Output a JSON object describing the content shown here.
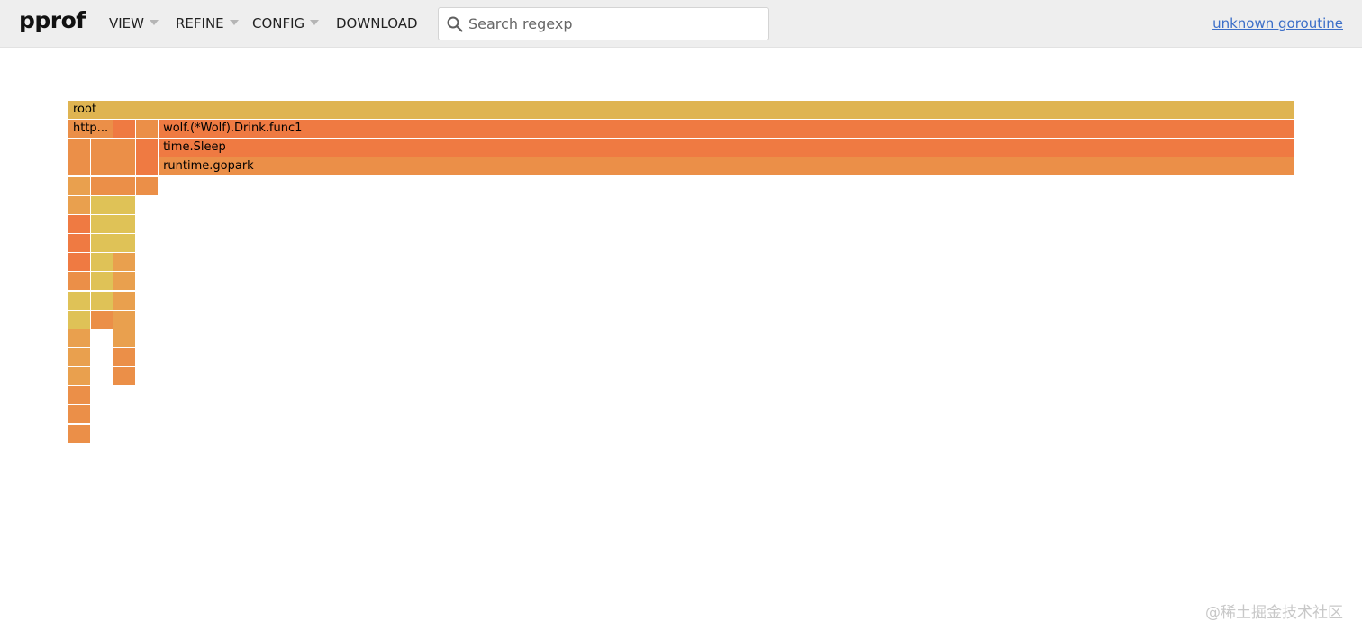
{
  "app": {
    "logo": "pprof"
  },
  "menu": {
    "view": "VIEW",
    "refine": "REFINE",
    "config": "CONFIG",
    "download": "DOWNLOAD"
  },
  "search": {
    "placeholder": "Search regexp",
    "value": ""
  },
  "profile_link": "unknown goroutine",
  "colors": {
    "header_bg": "#eeeeee",
    "link": "#3b6ec8",
    "root": "#dfb451",
    "deep_orange": "#ef7a42",
    "orange": "#eb8f48",
    "light_orange": "#e9a04e",
    "yellow": "#dfc257"
  },
  "flamegraph": {
    "frames": [
      {
        "label": "root",
        "row": 0,
        "col": 0,
        "span": 54.4,
        "color": "root"
      },
      {
        "label": "http...",
        "row": 1,
        "col": 0,
        "span": 2,
        "color": "orange"
      },
      {
        "label": "",
        "row": 1,
        "col": 2,
        "span": 1,
        "color": "deep_orange"
      },
      {
        "label": "",
        "row": 1,
        "col": 3,
        "span": 1,
        "color": "orange"
      },
      {
        "label": "wolf.(*Wolf).Drink.func1",
        "row": 1,
        "col": 4,
        "span": 50.4,
        "color": "deep_orange"
      },
      {
        "label": "",
        "row": 2,
        "col": 0,
        "span": 1,
        "color": "orange"
      },
      {
        "label": "",
        "row": 2,
        "col": 1,
        "span": 1,
        "color": "orange"
      },
      {
        "label": "",
        "row": 2,
        "col": 2,
        "span": 1,
        "color": "orange"
      },
      {
        "label": "",
        "row": 2,
        "col": 3,
        "span": 1,
        "color": "deep_orange"
      },
      {
        "label": "time.Sleep",
        "row": 2,
        "col": 4,
        "span": 50.4,
        "color": "deep_orange"
      },
      {
        "label": "",
        "row": 3,
        "col": 0,
        "span": 1,
        "color": "orange"
      },
      {
        "label": "",
        "row": 3,
        "col": 1,
        "span": 1,
        "color": "orange"
      },
      {
        "label": "",
        "row": 3,
        "col": 2,
        "span": 1,
        "color": "orange"
      },
      {
        "label": "",
        "row": 3,
        "col": 3,
        "span": 1,
        "color": "deep_orange"
      },
      {
        "label": "runtime.gopark",
        "row": 3,
        "col": 4,
        "span": 50.4,
        "color": "orange"
      },
      {
        "label": "",
        "row": 4,
        "col": 0,
        "span": 1,
        "color": "light_orange"
      },
      {
        "label": "",
        "row": 4,
        "col": 1,
        "span": 1,
        "color": "orange"
      },
      {
        "label": "",
        "row": 4,
        "col": 2,
        "span": 1,
        "color": "orange"
      },
      {
        "label": "",
        "row": 4,
        "col": 3,
        "span": 1,
        "color": "orange"
      },
      {
        "label": "",
        "row": 5,
        "col": 0,
        "span": 1,
        "color": "light_orange"
      },
      {
        "label": "",
        "row": 5,
        "col": 1,
        "span": 1,
        "color": "yellow"
      },
      {
        "label": "",
        "row": 5,
        "col": 2,
        "span": 1,
        "color": "yellow"
      },
      {
        "label": "",
        "row": 6,
        "col": 0,
        "span": 1,
        "color": "deep_orange"
      },
      {
        "label": "",
        "row": 6,
        "col": 1,
        "span": 1,
        "color": "yellow"
      },
      {
        "label": "",
        "row": 6,
        "col": 2,
        "span": 1,
        "color": "yellow"
      },
      {
        "label": "",
        "row": 7,
        "col": 0,
        "span": 1,
        "color": "deep_orange"
      },
      {
        "label": "",
        "row": 7,
        "col": 1,
        "span": 1,
        "color": "yellow"
      },
      {
        "label": "",
        "row": 7,
        "col": 2,
        "span": 1,
        "color": "yellow"
      },
      {
        "label": "",
        "row": 8,
        "col": 0,
        "span": 1,
        "color": "deep_orange"
      },
      {
        "label": "",
        "row": 8,
        "col": 1,
        "span": 1,
        "color": "yellow"
      },
      {
        "label": "",
        "row": 8,
        "col": 2,
        "span": 1,
        "color": "light_orange"
      },
      {
        "label": "",
        "row": 9,
        "col": 0,
        "span": 1,
        "color": "orange"
      },
      {
        "label": "",
        "row": 9,
        "col": 1,
        "span": 1,
        "color": "yellow"
      },
      {
        "label": "",
        "row": 9,
        "col": 2,
        "span": 1,
        "color": "light_orange"
      },
      {
        "label": "",
        "row": 10,
        "col": 0,
        "span": 1,
        "color": "yellow"
      },
      {
        "label": "",
        "row": 10,
        "col": 1,
        "span": 1,
        "color": "yellow"
      },
      {
        "label": "",
        "row": 10,
        "col": 2,
        "span": 1,
        "color": "light_orange"
      },
      {
        "label": "",
        "row": 11,
        "col": 0,
        "span": 1,
        "color": "yellow"
      },
      {
        "label": "",
        "row": 11,
        "col": 1,
        "span": 1,
        "color": "orange"
      },
      {
        "label": "",
        "row": 11,
        "col": 2,
        "span": 1,
        "color": "light_orange"
      },
      {
        "label": "",
        "row": 12,
        "col": 0,
        "span": 1,
        "color": "light_orange"
      },
      {
        "label": "",
        "row": 12,
        "col": 2,
        "span": 1,
        "color": "light_orange"
      },
      {
        "label": "",
        "row": 13,
        "col": 0,
        "span": 1,
        "color": "light_orange"
      },
      {
        "label": "",
        "row": 13,
        "col": 2,
        "span": 1,
        "color": "orange"
      },
      {
        "label": "",
        "row": 14,
        "col": 0,
        "span": 1,
        "color": "light_orange"
      },
      {
        "label": "",
        "row": 14,
        "col": 2,
        "span": 1,
        "color": "orange"
      },
      {
        "label": "",
        "row": 15,
        "col": 0,
        "span": 1,
        "color": "orange"
      },
      {
        "label": "",
        "row": 16,
        "col": 0,
        "span": 1,
        "color": "orange"
      },
      {
        "label": "",
        "row": 17,
        "col": 0,
        "span": 1,
        "color": "orange"
      }
    ]
  },
  "watermark": "@稀土掘金技术社区"
}
